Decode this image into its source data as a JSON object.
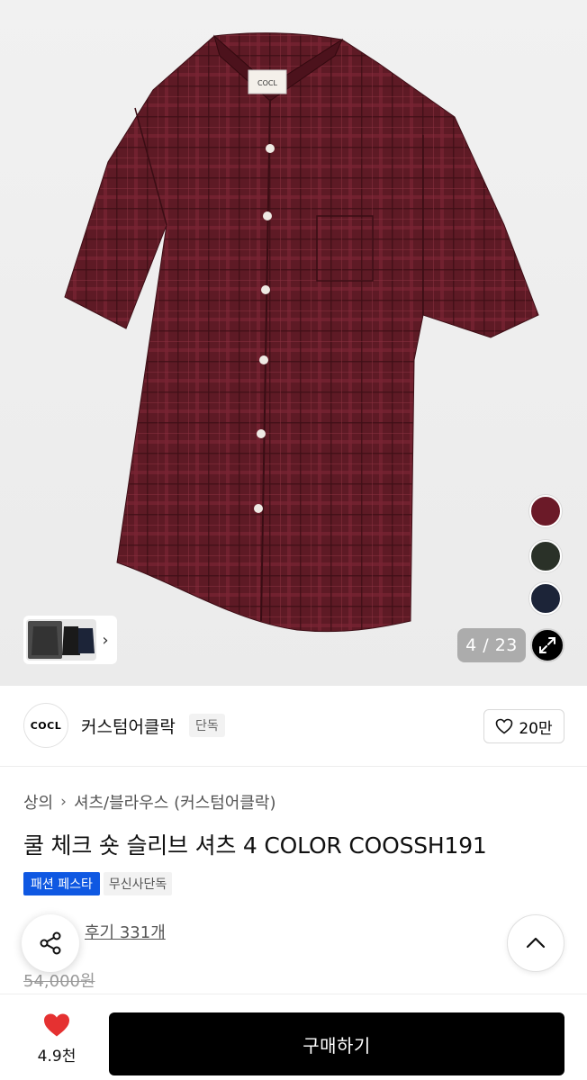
{
  "hero": {
    "counter": "4 / 23",
    "label_brand_text": "COCL",
    "swatches": [
      {
        "name": "burgundy",
        "color": "#6b1a28"
      },
      {
        "name": "dark-green",
        "color": "#2a3128"
      },
      {
        "name": "navy",
        "color": "#1c2438"
      }
    ],
    "shirt_color": "#5e1a25"
  },
  "brand": {
    "logo_text": "COCL",
    "name": "커스텀어클락",
    "tag": "단독",
    "likes": "20만"
  },
  "product": {
    "breadcrumb": [
      "상의",
      "셔츠/블라우스 (커스텀어클락)"
    ],
    "title": "쿨 체크 숏 슬리브 셔츠 4 COLOR COOSSH191",
    "badges": {
      "blue": "패션 페스타",
      "gray": "무신사단독"
    },
    "review_text": "후기 331개",
    "original_price": "54,000원"
  },
  "bottom": {
    "heart_count": "4.9천",
    "buy_label": "구매하기"
  },
  "colors": {
    "accent_blue": "#0f58e2",
    "heart_red": "#e53131",
    "button_black": "#000000"
  }
}
